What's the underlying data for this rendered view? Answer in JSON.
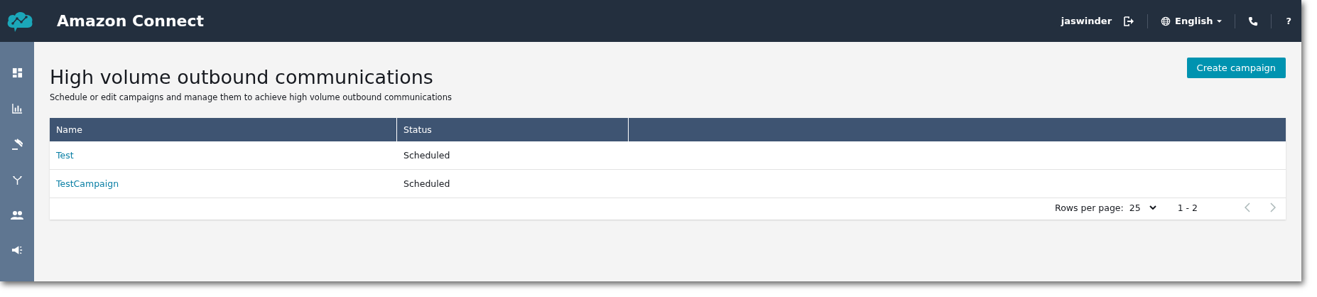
{
  "header": {
    "title": "Amazon Connect",
    "user": "jaswinder",
    "language": "English",
    "help": "?"
  },
  "sidebar": {
    "items": [
      {
        "kind": "dashboard"
      },
      {
        "kind": "metrics"
      },
      {
        "kind": "routing"
      },
      {
        "kind": "flows"
      },
      {
        "kind": "users"
      },
      {
        "kind": "campaigns"
      }
    ]
  },
  "page": {
    "title": "High volume outbound communications",
    "subtitle": "Schedule or edit campaigns and manage them to achieve high volume outbound communications",
    "button": "Create campaign"
  },
  "table": {
    "columns": [
      "Name",
      "Status"
    ],
    "rows": [
      {
        "name": "Test",
        "status": "Scheduled"
      },
      {
        "name": "TestCampaign",
        "status": "Scheduled"
      }
    ]
  },
  "pagination": {
    "label": "Rows per page:",
    "rows_per_page": "25",
    "range": "1 - 2",
    "prev": {
      "disabled": true
    },
    "next": {
      "disabled": true
    }
  }
}
